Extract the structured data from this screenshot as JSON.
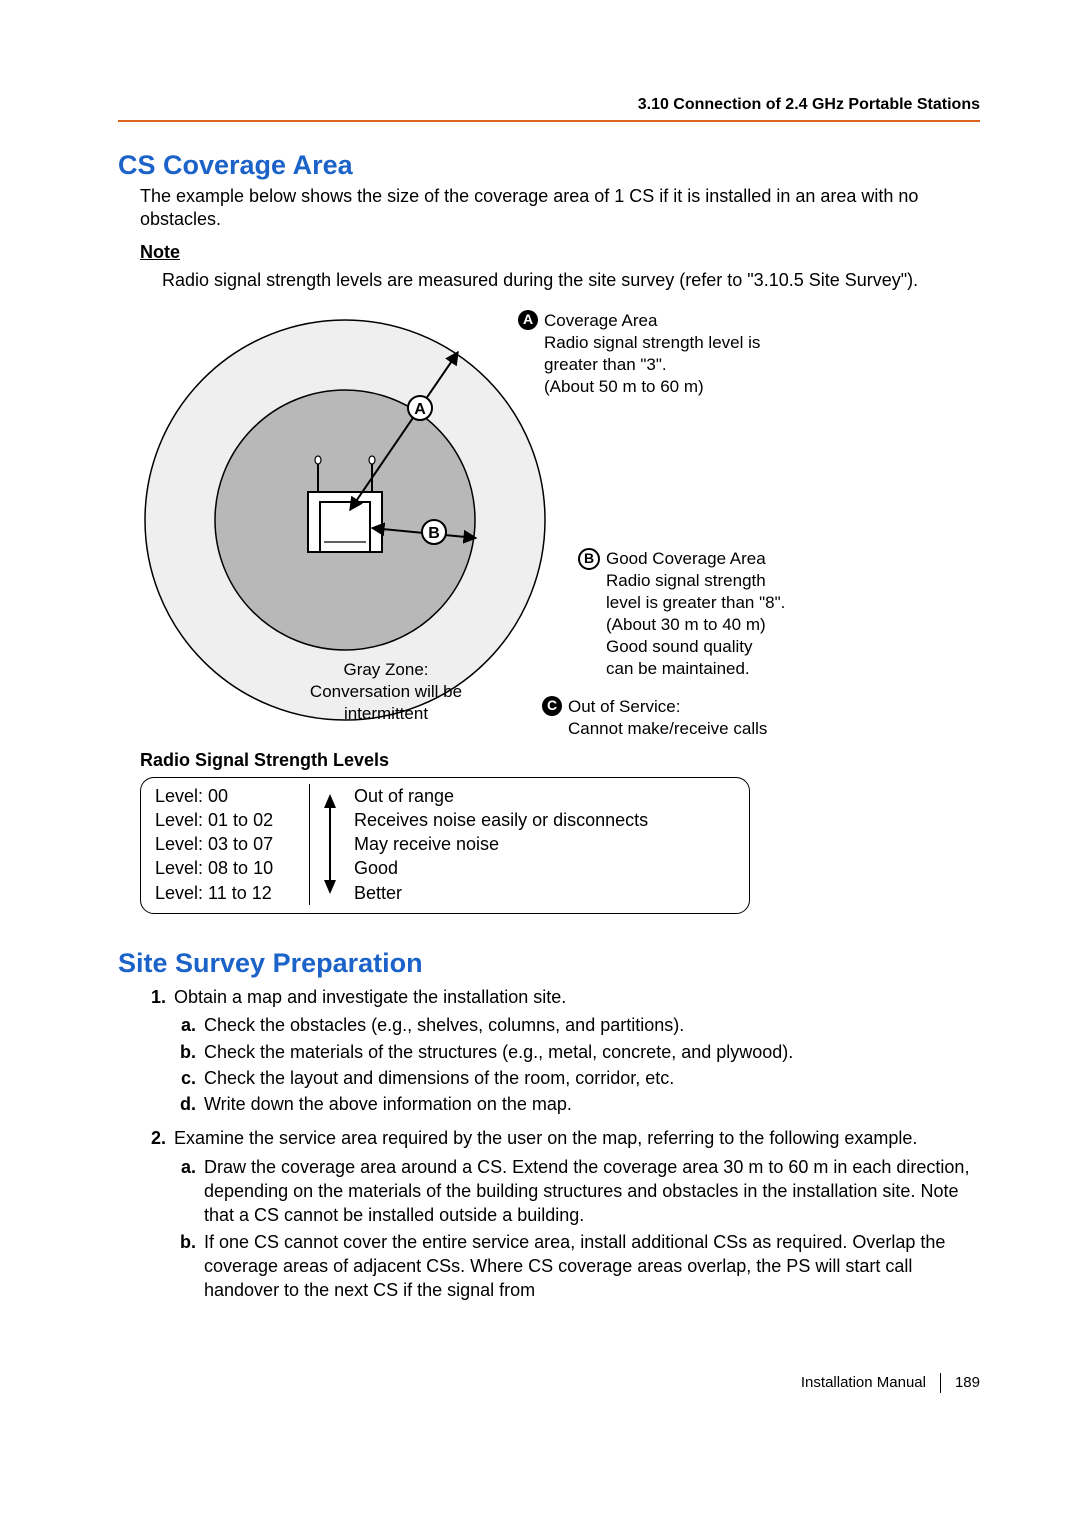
{
  "header": {
    "running": "3.10 Connection of 2.4 GHz Portable Stations"
  },
  "h2a": "CS Coverage Area",
  "lead": "The example below shows the size of the coverage area of 1 CS if it is installed in an area with no obstacles.",
  "note": {
    "label": "Note",
    "body": "Radio signal strength levels are measured during the site survey (refer to \"3.10.5 Site Survey\")."
  },
  "fig": {
    "labels": {
      "A": "A",
      "B": "B",
      "C": "C"
    },
    "calloutA": {
      "title": "Coverage Area",
      "lines": [
        "Radio signal strength level is",
        "greater than \"3\".",
        "(About 50 m to 60 m)"
      ]
    },
    "calloutB": {
      "title": "Good Coverage Area",
      "lines": [
        "Radio signal strength",
        "level is greater than \"8\".",
        "(About 30 m to 40 m)",
        "Good sound quality",
        "can be maintained."
      ]
    },
    "calloutC": {
      "title": "Out of Service:",
      "lines": [
        "Cannot make/receive calls"
      ]
    },
    "gray": {
      "l1": "Gray Zone:",
      "l2": "Conversation will be",
      "l3": "intermittent"
    }
  },
  "rss": {
    "title": "Radio Signal Strength Levels",
    "levels": [
      "Level: 00",
      "Level: 01 to 02",
      "Level: 03 to 07",
      "Level: 08 to 10",
      "Level: 11 to 12"
    ],
    "descs": [
      "Out of range",
      "Receives noise easily or disconnects",
      "May receive noise",
      "Good",
      "Better"
    ]
  },
  "h2b": "Site Survey Preparation",
  "list": {
    "i1": {
      "num": "1.",
      "text": "Obtain a map and investigate the installation site.",
      "sub": [
        {
          "l": "a.",
          "t": "Check the obstacles (e.g., shelves, columns, and partitions)."
        },
        {
          "l": "b.",
          "t": "Check the materials of the structures (e.g., metal, concrete, and plywood)."
        },
        {
          "l": "c.",
          "t": "Check the layout and dimensions of the room, corridor, etc."
        },
        {
          "l": "d.",
          "t": "Write down the above information on the map."
        }
      ]
    },
    "i2": {
      "num": "2.",
      "text": "Examine the service area required by the user on the map, referring to the following example.",
      "sub": [
        {
          "l": "a.",
          "t": "Draw the coverage area around a CS. Extend the coverage area 30 m to 60 m in each direction, depending on the materials of the building structures and obstacles in the installation site. Note that a CS cannot be installed outside a building."
        },
        {
          "l": "b.",
          "t": "If one CS cannot cover the entire service area, install additional CSs as required. Overlap the coverage areas of adjacent CSs.\nWhere CS coverage areas overlap, the PS will start call handover to the next CS if the signal from"
        }
      ]
    }
  },
  "footer": {
    "doc": "Installation Manual",
    "page": "189"
  }
}
